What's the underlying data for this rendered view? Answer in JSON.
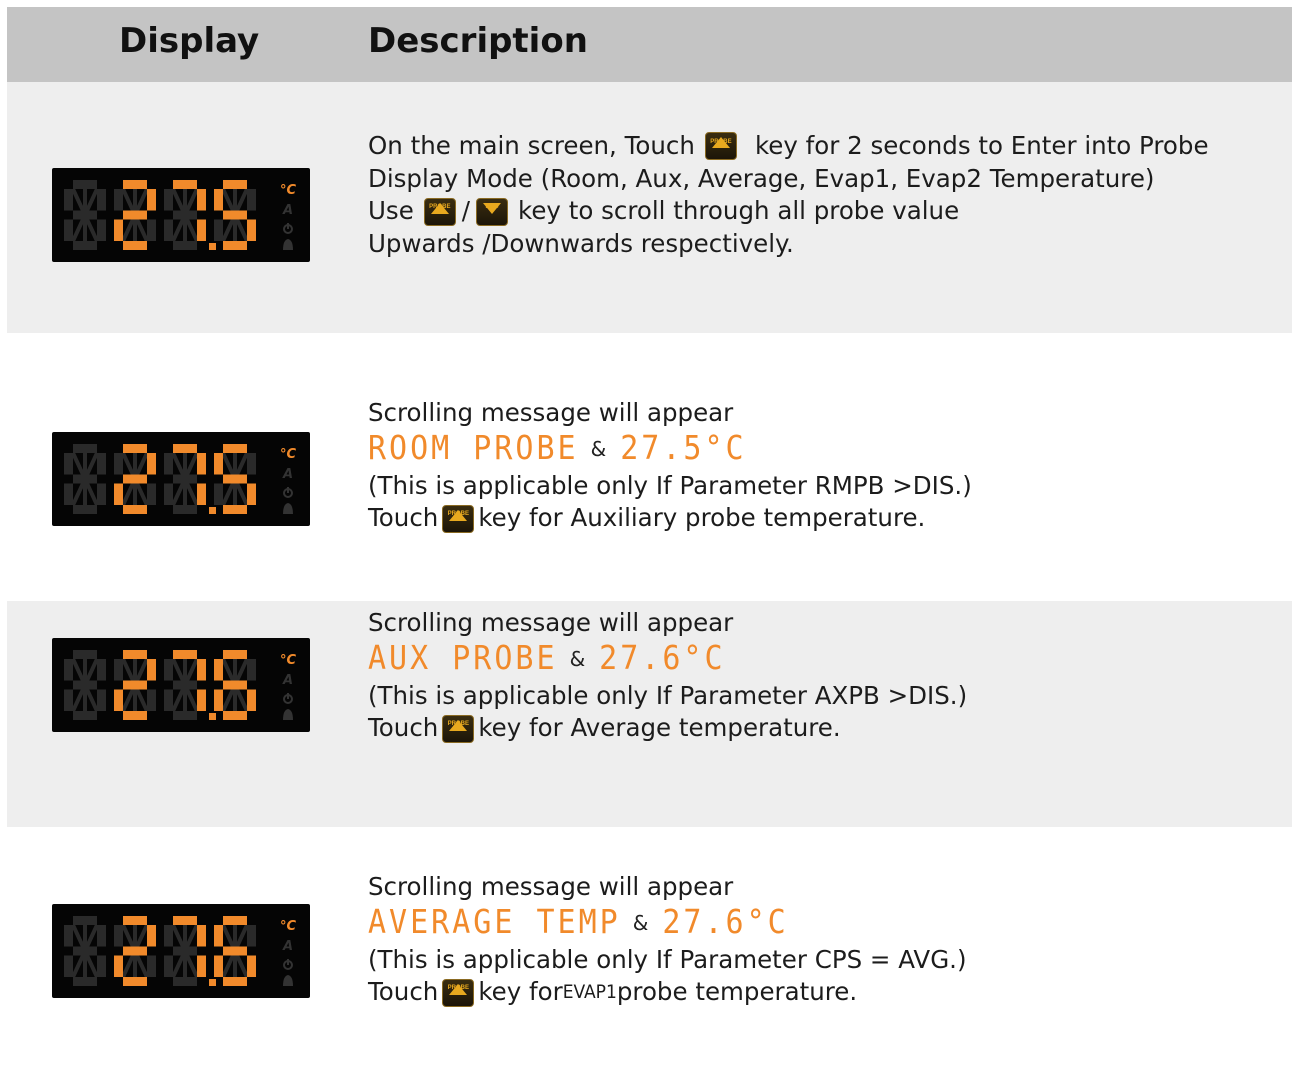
{
  "header": {
    "display": "Display",
    "description": "Description"
  },
  "display_reading": [
    {
      "digits": "275"
    },
    {
      "digits": "275"
    },
    {
      "digits": "276"
    },
    {
      "digits": "276"
    }
  ],
  "rows": [
    {
      "lines": [
        {
          "before": "On the main screen, Touch",
          "key": "PROBE",
          "after": "key for 2 seconds to Enter into Probe"
        },
        {
          "text": "Display Mode (Room, Aux, Average, Evap1, Evap2 Temperature)"
        },
        {
          "before": "Use",
          "key": "PROBE",
          "sep": "/",
          "key2": "PRG",
          "after": "key to scroll through all probe value"
        },
        {
          "text": "Upwards /Downwards respectively."
        }
      ]
    },
    {
      "intro": "Scrolling message will appear",
      "seg_message": "ROOM PROBE",
      "amp": "&",
      "seg_value": "27.5°C",
      "note": "(This is applicable only If Parameter RMPB >DIS.)",
      "touch_before": "Touch",
      "touch_key": "PROBE",
      "touch_after": "key for Auxiliary probe temperature."
    },
    {
      "intro": "Scrolling message will appear",
      "seg_message": "AUX PROBE",
      "amp": "&",
      "seg_value": "27.6°C",
      "note": "(This is applicable only If Parameter AXPB >DIS.)",
      "touch_before": "Touch",
      "touch_key": "PROBE",
      "touch_after": "key for Average temperature."
    },
    {
      "intro": "Scrolling message will appear",
      "seg_message": "AVERAGE TEMP",
      "amp": "&",
      "seg_value": "27.6°C",
      "note": "(This is applicable only If Parameter CPS = AVG.)",
      "touch_before": "Touch",
      "touch_key": "PROBE",
      "touch_after_small": "EVAP1",
      "touch_after": " probe temperature.",
      "touch_after_prefix": "key for "
    }
  ],
  "colors": {
    "segment_on": "#f18a2b",
    "segment_off": "#2a2a2a",
    "key_arrow": "#e8a91f"
  },
  "icons": [
    "celsius-icon",
    "auto-icon",
    "power-icon",
    "bell-icon",
    "up-arrow-icon",
    "down-arrow-icon"
  ]
}
